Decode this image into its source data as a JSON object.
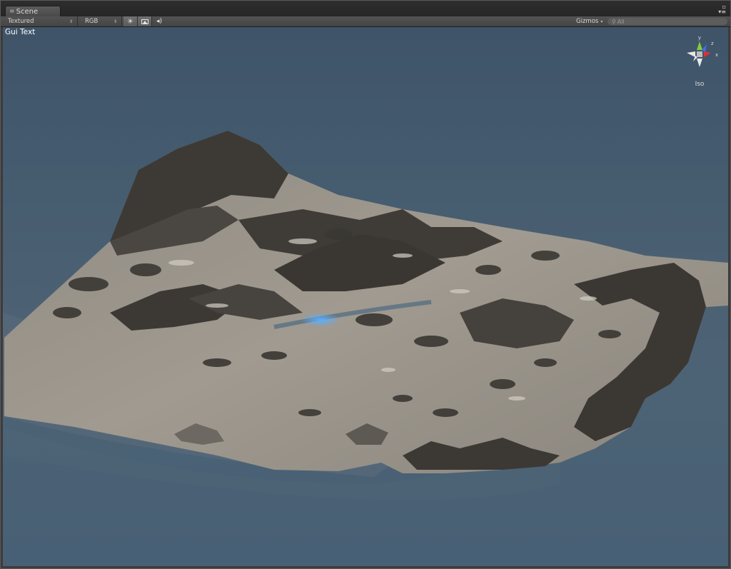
{
  "window": {
    "tab_title": "Scene",
    "tab_icon": "scene-grid-icon"
  },
  "toolbar": {
    "draw_mode": "Textured",
    "render_mode": "RGB",
    "lighting_icon": "sun-icon",
    "effects_icon": "image-icon",
    "audio_icon": "speaker-icon",
    "gizmos_label": "Gizmos",
    "search_placeholder": "All"
  },
  "viewport": {
    "gui_text": "Gui Text",
    "gizmo": {
      "y_label": "y",
      "z_label": "z",
      "x_label": "x",
      "projection": "Iso",
      "colors": {
        "y": "#7fcf3a",
        "z": "#3f6ff0",
        "x": "#e03030"
      }
    }
  }
}
